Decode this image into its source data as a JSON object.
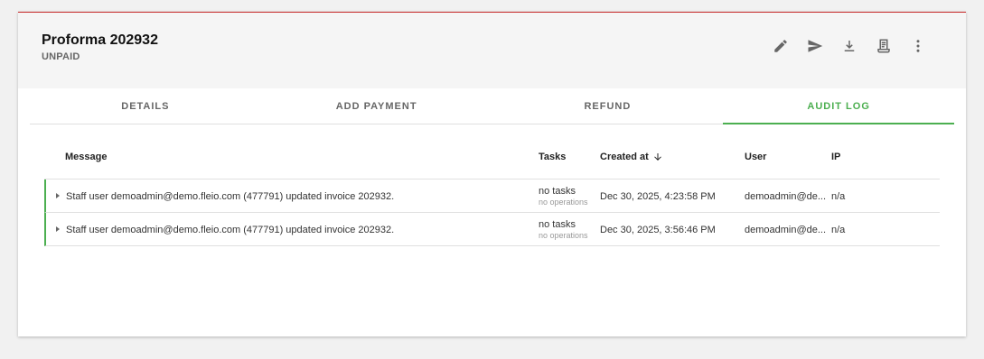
{
  "header": {
    "title": "Proforma 202932",
    "status": "UNPAID",
    "actions": [
      {
        "icon": "pencil-icon",
        "name": "edit"
      },
      {
        "icon": "send-icon",
        "name": "send"
      },
      {
        "icon": "download-icon",
        "name": "download"
      },
      {
        "icon": "receipt-icon",
        "name": "receipt"
      },
      {
        "icon": "more-vert-icon",
        "name": "more"
      }
    ]
  },
  "tabs": [
    {
      "label": "DETAILS",
      "active": false
    },
    {
      "label": "ADD PAYMENT",
      "active": false
    },
    {
      "label": "REFUND",
      "active": false
    },
    {
      "label": "AUDIT LOG",
      "active": true
    }
  ],
  "table": {
    "headers": {
      "message": "Message",
      "tasks": "Tasks",
      "created": "Created at",
      "user": "User",
      "ip": "IP"
    },
    "sort_icon": "arrow-down-icon",
    "rows": [
      {
        "message": "Staff user demoadmin@demo.fleio.com (477791) updated invoice 202932.",
        "tasks": "no tasks",
        "tasks_sub": "no operations",
        "created": "Dec 30, 2025, 4:23:58 PM",
        "user": "demoadmin@de...",
        "ip": "n/a"
      },
      {
        "message": "Staff user demoadmin@demo.fleio.com (477791) updated invoice 202932.",
        "tasks": "no tasks",
        "tasks_sub": "no operations",
        "created": "Dec 30, 2025, 3:56:46 PM",
        "user": "demoadmin@de...",
        "ip": "n/a"
      }
    ]
  },
  "colors": {
    "accent": "#4caf50",
    "top_border": "#c62828",
    "header_bg": "#f5f5f5",
    "page_bg": "#f1f1f1"
  }
}
